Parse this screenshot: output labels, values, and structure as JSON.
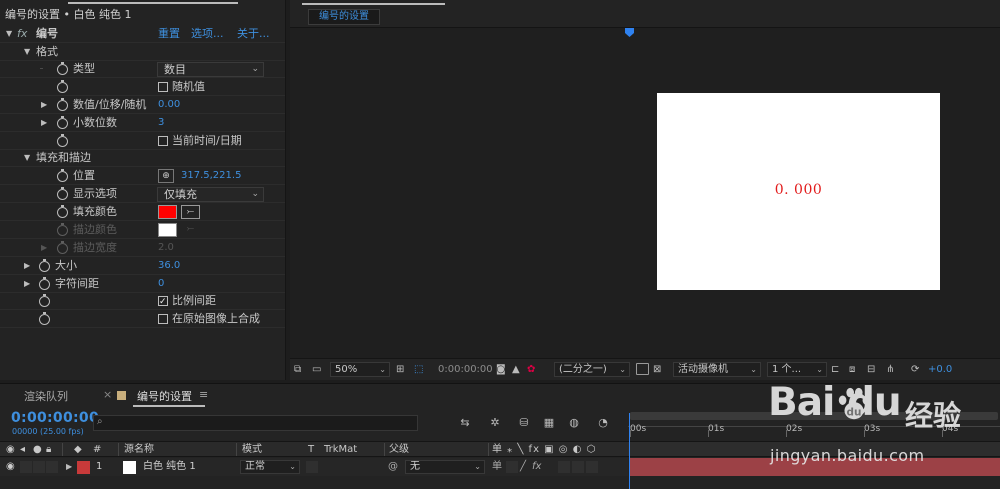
{
  "effect_controls": {
    "header": "编号的设置 • 白色 纯色 1",
    "effect_name": "编号",
    "links": {
      "reset": "重置",
      "options": "选项...",
      "about": "关于..."
    },
    "format_group": "格式",
    "type_label": "类型",
    "type_value": "数目",
    "random_label": "随机值",
    "value_offset_label": "数值/位移/随机",
    "value_offset_value": "0.00",
    "decimals_label": "小数位数",
    "decimals_value": "3",
    "current_time_label": "当前时间/日期",
    "fill_stroke_group": "填充和描边",
    "position_label": "位置",
    "position_value": "317.5,221.5",
    "display_options_label": "显示选项",
    "display_options_value": "仅填充",
    "fill_color_label": "填充颜色",
    "fill_color": "#ff0000",
    "stroke_color_label": "描边颜色",
    "stroke_color": "#ffffff",
    "stroke_width_label": "描边宽度",
    "stroke_width_value": "2.0",
    "size_label": "大小",
    "size_value": "36.0",
    "tracking_label": "字符间距",
    "tracking_value": "0",
    "proportional_label": "比例间距",
    "composite_label": "在原始图像上合成"
  },
  "viewer": {
    "comp_tab": "编号的设置",
    "canvas_text": "0. 000",
    "toolbar": {
      "zoom": "50%",
      "timecode": "0:00:00:00",
      "resolution": "(二分之一)",
      "camera": "活动摄像机",
      "views": "1 个...",
      "exposure": "+0.0"
    }
  },
  "timeline": {
    "tabs": {
      "render_queue": "渲染队列",
      "comp": "编号的设置",
      "close_glyph": "×",
      "menu_glyph": "≡"
    },
    "timecode": "0:00:00:00",
    "timecode_sub": "00000 (25.00 fps)",
    "search_glyph": "⌕",
    "columns": {
      "num": "#",
      "source": "源名称",
      "mode": "模式",
      "t": "T",
      "trkmat": "TrkMat",
      "parent": "父级",
      "switches": "单 ⁎ ╲ fx ▣ ◎ ◐ ⬡"
    },
    "layer": {
      "index": "1",
      "name": "白色 纯色 1",
      "mode": "正常",
      "parent": "无",
      "label_color": "#c83a3a"
    },
    "ruler": {
      "labels": [
        "00s",
        "01s",
        "02s",
        "03s",
        "04s"
      ]
    },
    "accent": "#3e8fde"
  },
  "watermark": {
    "brand": "Bai  du",
    "cn": "经验",
    "url": "jingyan.baidu.com"
  }
}
